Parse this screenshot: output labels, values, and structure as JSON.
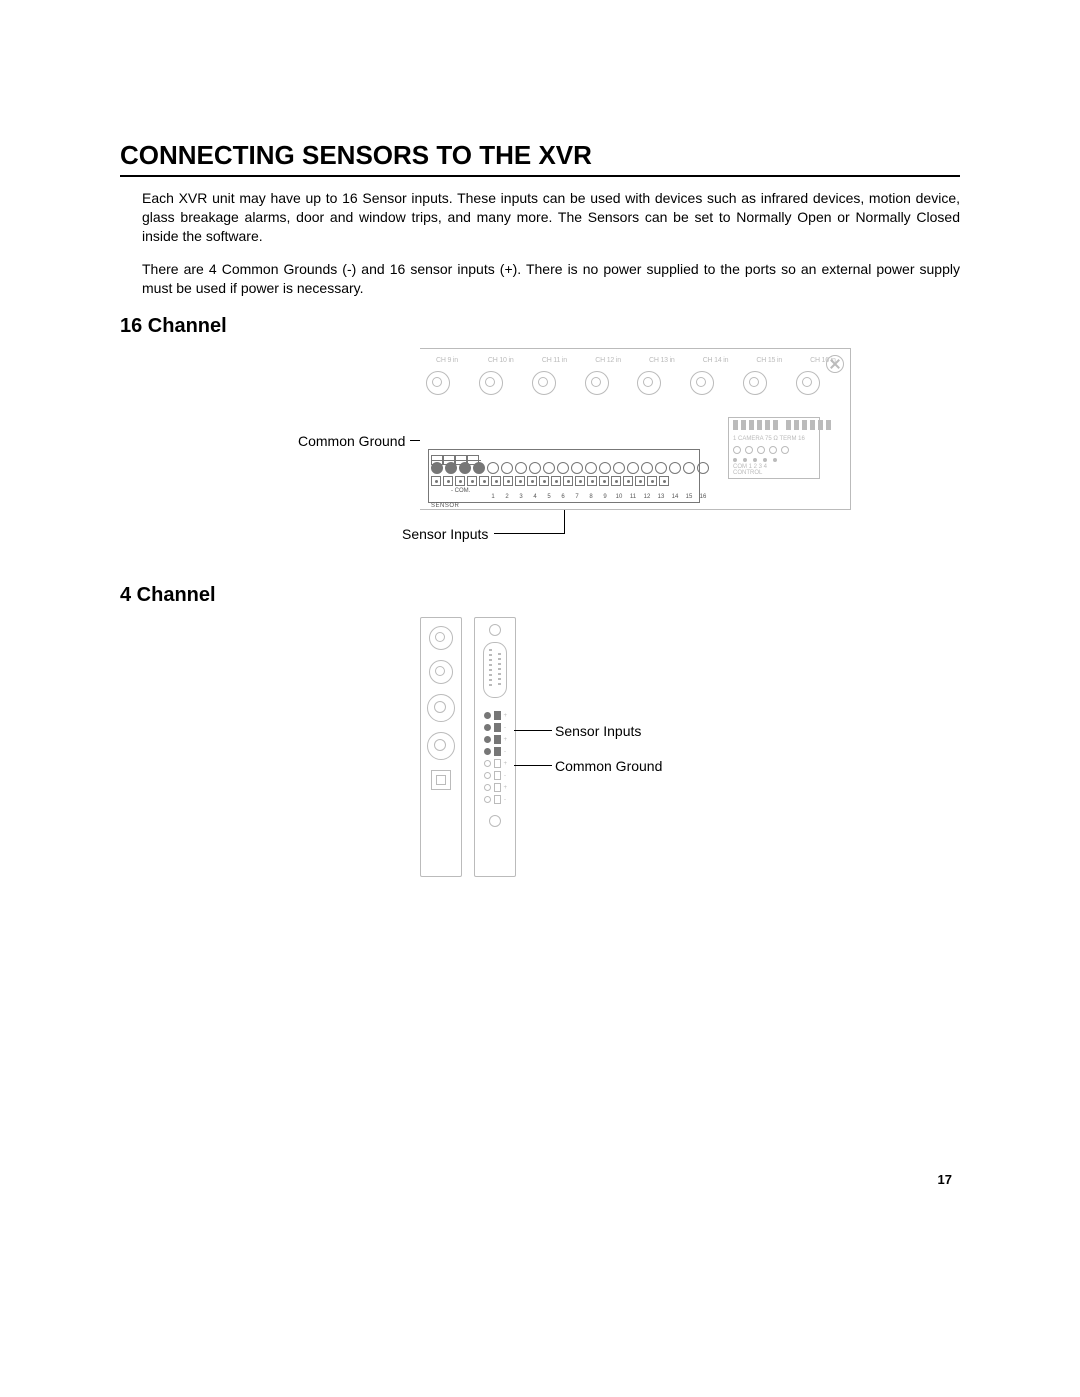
{
  "title": "CONNECTING SENSORS TO THE XVR",
  "para1": "Each XVR unit may have up to 16 Sensor inputs. These inputs can be used with devices such as infrared devices, motion device, glass breakage alarms, door and window trips, and many more. The Sensors can be set to Normally Open or Normally Closed inside the software.",
  "para2": "There are 4 Common Grounds (-) and 16 sensor inputs (+). There is no power supplied to the ports so an external power supply must be used if power is necessary.",
  "section16": "16 Channel",
  "section4": "4 Channel",
  "labels": {
    "common_ground": "Common Ground",
    "sensor_inputs": "Sensor Inputs"
  },
  "panel16": {
    "channels": [
      "CH 9 in",
      "CH 10 in",
      "CH 11 in",
      "CH 12 in",
      "CH 13 in",
      "CH 14 in",
      "CH 15 in",
      "CH 16 in"
    ],
    "dip_text_top": "1  CAMERA  75  Ω    TERM  16",
    "dip_text_bottom_left": "COM  1   2   3   4",
    "dip_text_bottom_right": "CONTROL",
    "tb_com_label": "- COM.",
    "tb_sensor_label": "SENSOR",
    "tb_numbers": [
      "",
      "",
      "",
      "",
      "1",
      "2",
      "3",
      "4",
      "5",
      "6",
      "7",
      "8",
      "9",
      "10",
      "11",
      "12",
      "13",
      "14",
      "15",
      "16"
    ]
  },
  "page_number": "17"
}
